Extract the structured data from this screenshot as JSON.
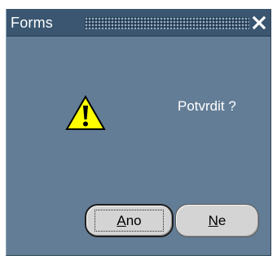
{
  "dialog": {
    "title": "Forms",
    "message": "Potvrdit ?",
    "icon": "warning-icon"
  },
  "buttons": {
    "yes": {
      "mnemonic": "A",
      "rest": "no"
    },
    "no": {
      "mnemonic": "N",
      "rest": "e"
    }
  },
  "colors": {
    "titlebar": "#3a5670",
    "body": "#637d96",
    "button": "#d4d4d4",
    "warning_fill": "#ffff00"
  }
}
